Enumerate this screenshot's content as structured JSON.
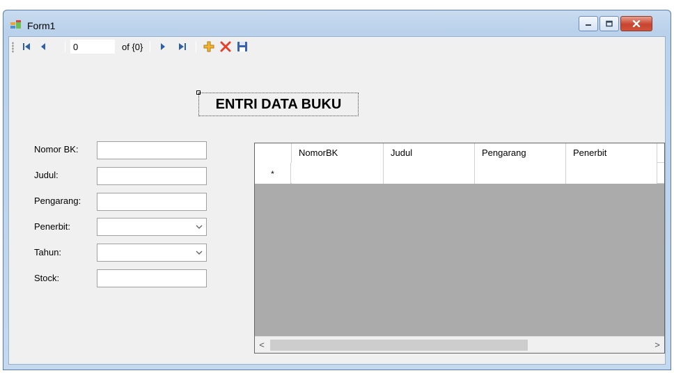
{
  "window": {
    "title": "Form1"
  },
  "navigator": {
    "position_value": "0",
    "count_label": "of {0}"
  },
  "form": {
    "heading": "ENTRI DATA BUKU",
    "fields": [
      {
        "label": "Nomor BK:",
        "value": ""
      },
      {
        "label": "Judul:",
        "value": ""
      },
      {
        "label": "Pengarang:",
        "value": ""
      },
      {
        "label": "Penerbit:",
        "value": ""
      },
      {
        "label": "Tahun:",
        "value": ""
      },
      {
        "label": "Stock:",
        "value": ""
      }
    ]
  },
  "grid": {
    "columns": [
      "NomorBK",
      "Judul",
      "Pengarang",
      "Penerbit"
    ],
    "new_row_marker": "*",
    "scroll_left": "<",
    "scroll_right": ">"
  },
  "colors": {
    "grid_background": "#ababab",
    "close_button": "#c7432e",
    "add_icon": "#f2b531",
    "delete_icon": "#e2402b",
    "save_icon": "#3a62b0"
  }
}
